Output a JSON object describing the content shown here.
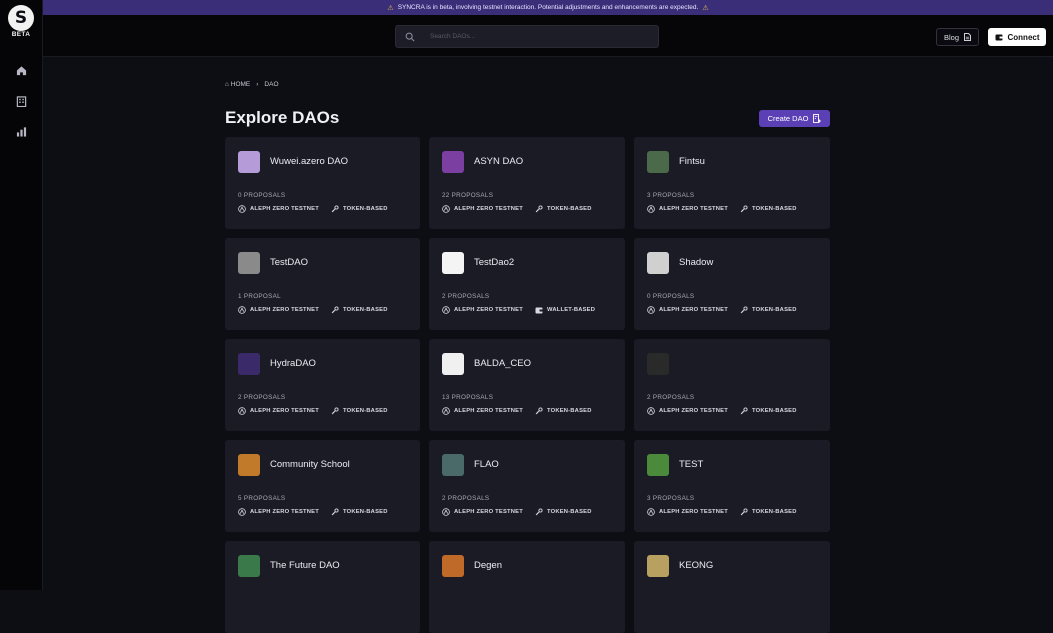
{
  "app": {
    "logo_glyph": "S",
    "badge": "BETA"
  },
  "banner": {
    "text": "SYNCRA is in beta, involving testnet interaction. Potential adjustments and enhancements are expected."
  },
  "search": {
    "placeholder": "Search DAOs..."
  },
  "header": {
    "blog_label": "Blog",
    "connect_label": "Connect"
  },
  "breadcrumb": {
    "home": "HOME",
    "separator": "›",
    "current": "DAO"
  },
  "page": {
    "title": "Explore DAOs",
    "create_label": "Create DAO"
  },
  "daos": [
    {
      "name": "Wuwei.azero DAO",
      "proposals": "0 PROPOSALS",
      "network": "ALEPH ZERO TESTNET",
      "type": "TOKEN-BASED",
      "avatar_color": "#b59bd8"
    },
    {
      "name": "ASYN DAO",
      "proposals": "22 PROPOSALS",
      "network": "ALEPH ZERO TESTNET",
      "type": "TOKEN-BASED",
      "avatar_color": "#7a3fa0"
    },
    {
      "name": "Fintsu",
      "proposals": "3 PROPOSALS",
      "network": "ALEPH ZERO TESTNET",
      "type": "TOKEN-BASED",
      "avatar_color": "#4a6a4a"
    },
    {
      "name": "TestDAO",
      "proposals": "1 PROPOSAL",
      "network": "ALEPH ZERO TESTNET",
      "type": "TOKEN-BASED",
      "avatar_color": "#8a8a8a"
    },
    {
      "name": "TestDao2",
      "proposals": "2 PROPOSALS",
      "network": "ALEPH ZERO TESTNET",
      "type": "WALLET-BASED",
      "avatar_color": "#f4f4f4"
    },
    {
      "name": "Shadow",
      "proposals": "0 PROPOSALS",
      "network": "ALEPH ZERO TESTNET",
      "type": "TOKEN-BASED",
      "avatar_color": "#d0d0d0"
    },
    {
      "name": "HydraDAO",
      "proposals": "2 PROPOSALS",
      "network": "ALEPH ZERO TESTNET",
      "type": "TOKEN-BASED",
      "avatar_color": "#3a2a6a"
    },
    {
      "name": "BALDA_CEO",
      "proposals": "13 PROPOSALS",
      "network": "ALEPH ZERO TESTNET",
      "type": "TOKEN-BASED",
      "avatar_color": "#f0f0f0"
    },
    {
      "name": "",
      "proposals": "2 PROPOSALS",
      "network": "ALEPH ZERO TESTNET",
      "type": "TOKEN-BASED",
      "avatar_color": "#2a2a2a"
    },
    {
      "name": "Community School",
      "proposals": "5 PROPOSALS",
      "network": "ALEPH ZERO TESTNET",
      "type": "TOKEN-BASED",
      "avatar_color": "#c07a2a"
    },
    {
      "name": "FLAO",
      "proposals": "2 PROPOSALS",
      "network": "ALEPH ZERO TESTNET",
      "type": "TOKEN-BASED",
      "avatar_color": "#4a6a6a"
    },
    {
      "name": "TEST",
      "proposals": "3 PROPOSALS",
      "network": "ALEPH ZERO TESTNET",
      "type": "TOKEN-BASED",
      "avatar_color": "#4a8a3a"
    },
    {
      "name": "The Future DAO",
      "proposals": "",
      "network": "",
      "type": "",
      "avatar_color": "#3a7a4a"
    },
    {
      "name": "Degen",
      "proposals": "",
      "network": "",
      "type": "",
      "avatar_color": "#c06a2a"
    },
    {
      "name": "KEONG",
      "proposals": "",
      "network": "",
      "type": "",
      "avatar_color": "#b8a060"
    }
  ],
  "colors": {
    "accent": "#5b3fb5",
    "banner": "#3a2e79",
    "card": "#1b1b25",
    "background": "#0d0d14"
  }
}
